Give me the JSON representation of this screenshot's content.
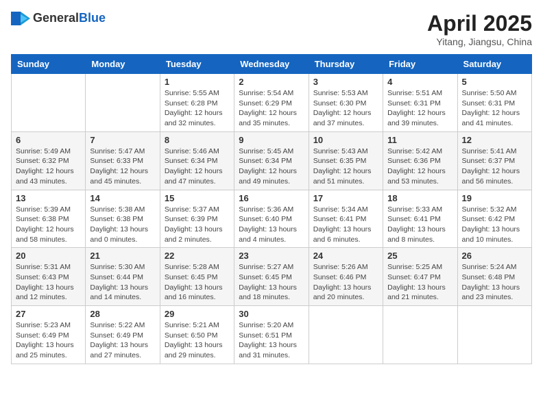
{
  "header": {
    "logo_general": "General",
    "logo_blue": "Blue",
    "month_title": "April 2025",
    "location": "Yitang, Jiangsu, China"
  },
  "weekdays": [
    "Sunday",
    "Monday",
    "Tuesday",
    "Wednesday",
    "Thursday",
    "Friday",
    "Saturday"
  ],
  "weeks": [
    [
      null,
      null,
      {
        "day": 1,
        "sunrise": "5:55 AM",
        "sunset": "6:28 PM",
        "daylight": "12 hours and 32 minutes."
      },
      {
        "day": 2,
        "sunrise": "5:54 AM",
        "sunset": "6:29 PM",
        "daylight": "12 hours and 35 minutes."
      },
      {
        "day": 3,
        "sunrise": "5:53 AM",
        "sunset": "6:30 PM",
        "daylight": "12 hours and 37 minutes."
      },
      {
        "day": 4,
        "sunrise": "5:51 AM",
        "sunset": "6:31 PM",
        "daylight": "12 hours and 39 minutes."
      },
      {
        "day": 5,
        "sunrise": "5:50 AM",
        "sunset": "6:31 PM",
        "daylight": "12 hours and 41 minutes."
      }
    ],
    [
      {
        "day": 6,
        "sunrise": "5:49 AM",
        "sunset": "6:32 PM",
        "daylight": "12 hours and 43 minutes."
      },
      {
        "day": 7,
        "sunrise": "5:47 AM",
        "sunset": "6:33 PM",
        "daylight": "12 hours and 45 minutes."
      },
      {
        "day": 8,
        "sunrise": "5:46 AM",
        "sunset": "6:34 PM",
        "daylight": "12 hours and 47 minutes."
      },
      {
        "day": 9,
        "sunrise": "5:45 AM",
        "sunset": "6:34 PM",
        "daylight": "12 hours and 49 minutes."
      },
      {
        "day": 10,
        "sunrise": "5:43 AM",
        "sunset": "6:35 PM",
        "daylight": "12 hours and 51 minutes."
      },
      {
        "day": 11,
        "sunrise": "5:42 AM",
        "sunset": "6:36 PM",
        "daylight": "12 hours and 53 minutes."
      },
      {
        "day": 12,
        "sunrise": "5:41 AM",
        "sunset": "6:37 PM",
        "daylight": "12 hours and 56 minutes."
      }
    ],
    [
      {
        "day": 13,
        "sunrise": "5:39 AM",
        "sunset": "6:38 PM",
        "daylight": "12 hours and 58 minutes."
      },
      {
        "day": 14,
        "sunrise": "5:38 AM",
        "sunset": "6:38 PM",
        "daylight": "13 hours and 0 minutes."
      },
      {
        "day": 15,
        "sunrise": "5:37 AM",
        "sunset": "6:39 PM",
        "daylight": "13 hours and 2 minutes."
      },
      {
        "day": 16,
        "sunrise": "5:36 AM",
        "sunset": "6:40 PM",
        "daylight": "13 hours and 4 minutes."
      },
      {
        "day": 17,
        "sunrise": "5:34 AM",
        "sunset": "6:41 PM",
        "daylight": "13 hours and 6 minutes."
      },
      {
        "day": 18,
        "sunrise": "5:33 AM",
        "sunset": "6:41 PM",
        "daylight": "13 hours and 8 minutes."
      },
      {
        "day": 19,
        "sunrise": "5:32 AM",
        "sunset": "6:42 PM",
        "daylight": "13 hours and 10 minutes."
      }
    ],
    [
      {
        "day": 20,
        "sunrise": "5:31 AM",
        "sunset": "6:43 PM",
        "daylight": "13 hours and 12 minutes."
      },
      {
        "day": 21,
        "sunrise": "5:30 AM",
        "sunset": "6:44 PM",
        "daylight": "13 hours and 14 minutes."
      },
      {
        "day": 22,
        "sunrise": "5:28 AM",
        "sunset": "6:45 PM",
        "daylight": "13 hours and 16 minutes."
      },
      {
        "day": 23,
        "sunrise": "5:27 AM",
        "sunset": "6:45 PM",
        "daylight": "13 hours and 18 minutes."
      },
      {
        "day": 24,
        "sunrise": "5:26 AM",
        "sunset": "6:46 PM",
        "daylight": "13 hours and 20 minutes."
      },
      {
        "day": 25,
        "sunrise": "5:25 AM",
        "sunset": "6:47 PM",
        "daylight": "13 hours and 21 minutes."
      },
      {
        "day": 26,
        "sunrise": "5:24 AM",
        "sunset": "6:48 PM",
        "daylight": "13 hours and 23 minutes."
      }
    ],
    [
      {
        "day": 27,
        "sunrise": "5:23 AM",
        "sunset": "6:49 PM",
        "daylight": "13 hours and 25 minutes."
      },
      {
        "day": 28,
        "sunrise": "5:22 AM",
        "sunset": "6:49 PM",
        "daylight": "13 hours and 27 minutes."
      },
      {
        "day": 29,
        "sunrise": "5:21 AM",
        "sunset": "6:50 PM",
        "daylight": "13 hours and 29 minutes."
      },
      {
        "day": 30,
        "sunrise": "5:20 AM",
        "sunset": "6:51 PM",
        "daylight": "13 hours and 31 minutes."
      },
      null,
      null,
      null
    ]
  ],
  "labels": {
    "sunrise": "Sunrise:",
    "sunset": "Sunset:",
    "daylight": "Daylight:"
  }
}
